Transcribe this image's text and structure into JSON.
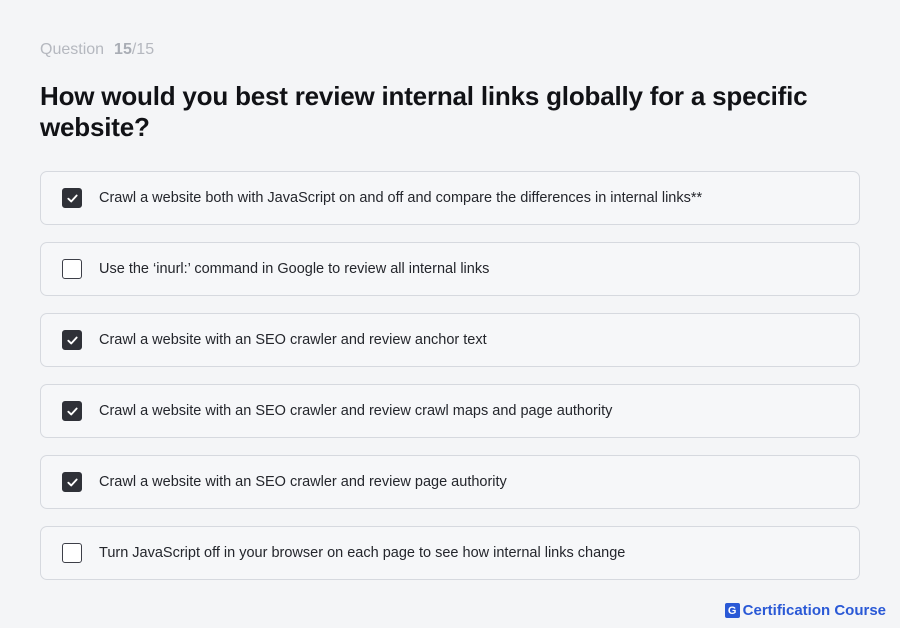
{
  "question": {
    "label": "Question",
    "current": "15",
    "total": "/15",
    "title": "How would you best review internal links globally for a specific website?"
  },
  "options": [
    {
      "label": "Crawl a website both with JavaScript on and off and compare the differences in internal links**",
      "checked": true
    },
    {
      "label": "Use the ‘inurl:’ command in Google to review all internal links",
      "checked": false
    },
    {
      "label": "Crawl a website with an SEO crawler and review anchor text",
      "checked": true
    },
    {
      "label": "Crawl a website with an SEO crawler and review crawl maps and page authority",
      "checked": true
    },
    {
      "label": "Crawl a website with an SEO crawler and review page authority",
      "checked": true
    },
    {
      "label": "Turn JavaScript off in your browser on each page to see how internal links change",
      "checked": false
    }
  ],
  "brand": {
    "logo_letter": "G",
    "name": "Certification Course",
    "color": "#2a59d6"
  },
  "colors": {
    "checked_fill": "#2f3138",
    "background": "#f4f5f7"
  },
  "icons": {
    "check": "check-icon",
    "logo": "brand-logo-icon"
  }
}
